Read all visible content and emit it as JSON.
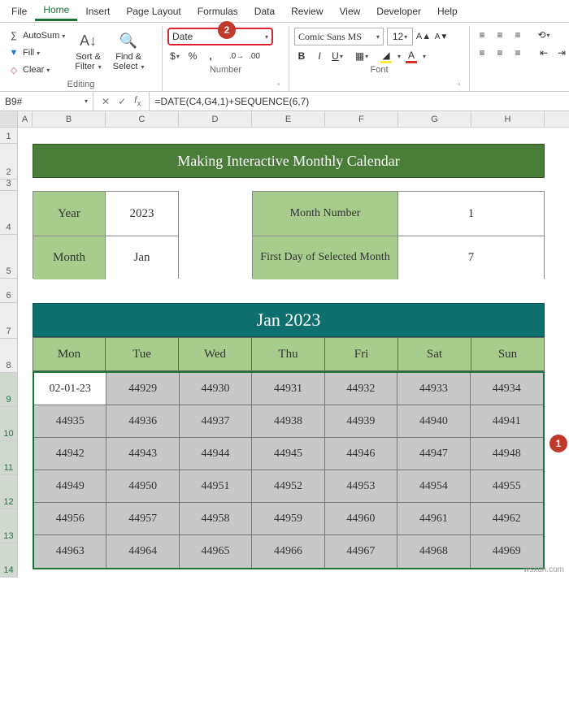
{
  "tabs": [
    "File",
    "Home",
    "Insert",
    "Page Layout",
    "Formulas",
    "Data",
    "Review",
    "View",
    "Developer",
    "Help"
  ],
  "active_tab": 1,
  "ribbon": {
    "editing": {
      "autosum": "AutoSum",
      "fill": "Fill",
      "clear": "Clear",
      "sortfilter_top": "Sort &",
      "sortfilter_bot": "Filter",
      "findsel_top": "Find &",
      "findsel_bot": "Select",
      "label": "Editing"
    },
    "number": {
      "format": "Date",
      "label": "Number"
    },
    "font": {
      "name": "Comic Sans MS",
      "size": "12",
      "label": "Font"
    },
    "alignment": {
      "label": ""
    }
  },
  "namebox": "B9#",
  "formula": "=DATE(C4,G4,1)+SEQUENCE(6,7)",
  "columns": [
    "A",
    "B",
    "C",
    "D",
    "E",
    "F",
    "G",
    "H"
  ],
  "rows": [
    "1",
    "2",
    "3",
    "4",
    "5",
    "6",
    "7",
    "8",
    "9",
    "10",
    "11",
    "12",
    "13",
    "14"
  ],
  "banner": "Making Interactive Monthly Calendar",
  "ym": {
    "year_label": "Year",
    "year_value": "2023",
    "month_label": "Month",
    "month_value": "Jan"
  },
  "info": {
    "mn_label": "Month Number",
    "mn_value": "1",
    "fd_label": "First Day of Selected Month",
    "fd_value": "7"
  },
  "cal_title": "Jan 2023",
  "cal_days": [
    "Mon",
    "Tue",
    "Wed",
    "Thu",
    "Fri",
    "Sat",
    "Sun"
  ],
  "cal": [
    [
      "02-01-23",
      "44929",
      "44930",
      "44931",
      "44932",
      "44933",
      "44934"
    ],
    [
      "44935",
      "44936",
      "44937",
      "44938",
      "44939",
      "44940",
      "44941"
    ],
    [
      "44942",
      "44943",
      "44944",
      "44945",
      "44946",
      "44947",
      "44948"
    ],
    [
      "44949",
      "44950",
      "44951",
      "44952",
      "44953",
      "44954",
      "44955"
    ],
    [
      "44956",
      "44957",
      "44958",
      "44959",
      "44960",
      "44961",
      "44962"
    ],
    [
      "44963",
      "44964",
      "44965",
      "44966",
      "44967",
      "44968",
      "44969"
    ]
  ],
  "callouts": {
    "c1": "1",
    "c2": "2"
  },
  "watermark": "wsxdn.com"
}
